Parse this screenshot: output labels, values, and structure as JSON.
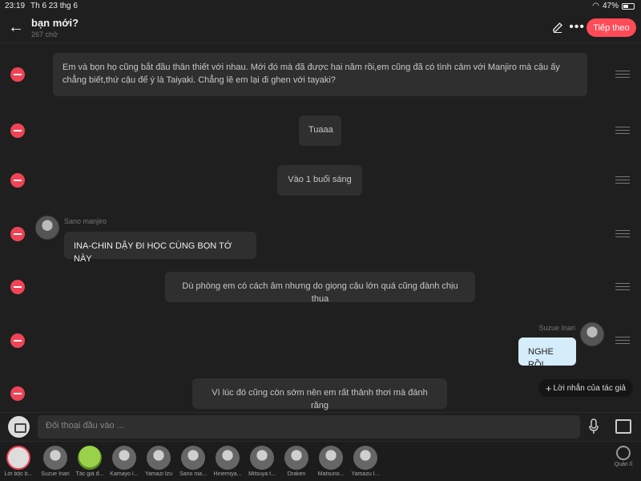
{
  "status": {
    "time": "23:19",
    "date": "Th 6 23 thg 6",
    "battery": "47%",
    "battery_level": 0.47
  },
  "header": {
    "title": "bạn mới?",
    "subtitle": "267 chữ",
    "next_label": "Tiếp theo"
  },
  "messages": [
    {
      "text": "Em và bọn họ cũng bắt đầu thân thiết với nhau. Mới đó mà đã được hai năm rồi,em cũng đã có tình cảm với Manjiro mà cậu ấy chẳng biết,thứ cậu để ý là Taiyaki. Chẳng lẽ em lại đi ghen với tayaki?"
    },
    {
      "text": "Tuaaa"
    },
    {
      "text": "Vào 1 buổi sáng"
    },
    {
      "speaker": "Sano manjiro",
      "text": "INA-CHIN DẬY ĐI HỌC CÙNG BỌN TỚ NÀY"
    },
    {
      "text": "Dù phòng em có cách âm nhưng do giọng cậu lớn quá cũng đành chịu thua"
    },
    {
      "speaker": "Suzue Inari",
      "text": "NGHE RỒI"
    },
    {
      "text": "Vì lúc đó cũng còn sớm nên em rất thảnh thơi mà đánh răng"
    }
  ],
  "author_note_label": "Lời nhắn của tác giả",
  "input": {
    "placeholder": "Đối thoại đầu vào ..."
  },
  "characters": [
    {
      "name": "Lời bộc b..."
    },
    {
      "name": "Suzue Inari"
    },
    {
      "name": "Tác giả đ..."
    },
    {
      "name": "Kamayo I..."
    },
    {
      "name": "Yamazi Izu"
    },
    {
      "name": "Sano ma..."
    },
    {
      "name": "Hinemiya..."
    },
    {
      "name": "Mitsuya t..."
    },
    {
      "name": "Draken"
    },
    {
      "name": "Matsuno..."
    },
    {
      "name": "Yamazu I..."
    }
  ],
  "manage_label": "Quản lí"
}
